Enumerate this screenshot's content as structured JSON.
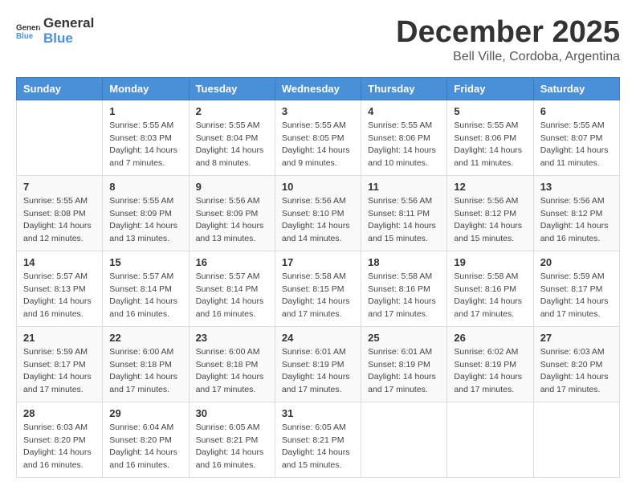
{
  "logo": {
    "general": "General",
    "blue": "Blue"
  },
  "header": {
    "month": "December 2025",
    "location": "Bell Ville, Cordoba, Argentina"
  },
  "weekdays": [
    "Sunday",
    "Monday",
    "Tuesday",
    "Wednesday",
    "Thursday",
    "Friday",
    "Saturday"
  ],
  "weeks": [
    [
      {
        "day": "",
        "sunrise": "",
        "sunset": "",
        "daylight": ""
      },
      {
        "day": "1",
        "sunrise": "Sunrise: 5:55 AM",
        "sunset": "Sunset: 8:03 PM",
        "daylight": "Daylight: 14 hours and 7 minutes."
      },
      {
        "day": "2",
        "sunrise": "Sunrise: 5:55 AM",
        "sunset": "Sunset: 8:04 PM",
        "daylight": "Daylight: 14 hours and 8 minutes."
      },
      {
        "day": "3",
        "sunrise": "Sunrise: 5:55 AM",
        "sunset": "Sunset: 8:05 PM",
        "daylight": "Daylight: 14 hours and 9 minutes."
      },
      {
        "day": "4",
        "sunrise": "Sunrise: 5:55 AM",
        "sunset": "Sunset: 8:06 PM",
        "daylight": "Daylight: 14 hours and 10 minutes."
      },
      {
        "day": "5",
        "sunrise": "Sunrise: 5:55 AM",
        "sunset": "Sunset: 8:06 PM",
        "daylight": "Daylight: 14 hours and 11 minutes."
      },
      {
        "day": "6",
        "sunrise": "Sunrise: 5:55 AM",
        "sunset": "Sunset: 8:07 PM",
        "daylight": "Daylight: 14 hours and 11 minutes."
      }
    ],
    [
      {
        "day": "7",
        "sunrise": "Sunrise: 5:55 AM",
        "sunset": "Sunset: 8:08 PM",
        "daylight": "Daylight: 14 hours and 12 minutes."
      },
      {
        "day": "8",
        "sunrise": "Sunrise: 5:55 AM",
        "sunset": "Sunset: 8:09 PM",
        "daylight": "Daylight: 14 hours and 13 minutes."
      },
      {
        "day": "9",
        "sunrise": "Sunrise: 5:56 AM",
        "sunset": "Sunset: 8:09 PM",
        "daylight": "Daylight: 14 hours and 13 minutes."
      },
      {
        "day": "10",
        "sunrise": "Sunrise: 5:56 AM",
        "sunset": "Sunset: 8:10 PM",
        "daylight": "Daylight: 14 hours and 14 minutes."
      },
      {
        "day": "11",
        "sunrise": "Sunrise: 5:56 AM",
        "sunset": "Sunset: 8:11 PM",
        "daylight": "Daylight: 14 hours and 15 minutes."
      },
      {
        "day": "12",
        "sunrise": "Sunrise: 5:56 AM",
        "sunset": "Sunset: 8:12 PM",
        "daylight": "Daylight: 14 hours and 15 minutes."
      },
      {
        "day": "13",
        "sunrise": "Sunrise: 5:56 AM",
        "sunset": "Sunset: 8:12 PM",
        "daylight": "Daylight: 14 hours and 16 minutes."
      }
    ],
    [
      {
        "day": "14",
        "sunrise": "Sunrise: 5:57 AM",
        "sunset": "Sunset: 8:13 PM",
        "daylight": "Daylight: 14 hours and 16 minutes."
      },
      {
        "day": "15",
        "sunrise": "Sunrise: 5:57 AM",
        "sunset": "Sunset: 8:14 PM",
        "daylight": "Daylight: 14 hours and 16 minutes."
      },
      {
        "day": "16",
        "sunrise": "Sunrise: 5:57 AM",
        "sunset": "Sunset: 8:14 PM",
        "daylight": "Daylight: 14 hours and 16 minutes."
      },
      {
        "day": "17",
        "sunrise": "Sunrise: 5:58 AM",
        "sunset": "Sunset: 8:15 PM",
        "daylight": "Daylight: 14 hours and 17 minutes."
      },
      {
        "day": "18",
        "sunrise": "Sunrise: 5:58 AM",
        "sunset": "Sunset: 8:16 PM",
        "daylight": "Daylight: 14 hours and 17 minutes."
      },
      {
        "day": "19",
        "sunrise": "Sunrise: 5:58 AM",
        "sunset": "Sunset: 8:16 PM",
        "daylight": "Daylight: 14 hours and 17 minutes."
      },
      {
        "day": "20",
        "sunrise": "Sunrise: 5:59 AM",
        "sunset": "Sunset: 8:17 PM",
        "daylight": "Daylight: 14 hours and 17 minutes."
      }
    ],
    [
      {
        "day": "21",
        "sunrise": "Sunrise: 5:59 AM",
        "sunset": "Sunset: 8:17 PM",
        "daylight": "Daylight: 14 hours and 17 minutes."
      },
      {
        "day": "22",
        "sunrise": "Sunrise: 6:00 AM",
        "sunset": "Sunset: 8:18 PM",
        "daylight": "Daylight: 14 hours and 17 minutes."
      },
      {
        "day": "23",
        "sunrise": "Sunrise: 6:00 AM",
        "sunset": "Sunset: 8:18 PM",
        "daylight": "Daylight: 14 hours and 17 minutes."
      },
      {
        "day": "24",
        "sunrise": "Sunrise: 6:01 AM",
        "sunset": "Sunset: 8:19 PM",
        "daylight": "Daylight: 14 hours and 17 minutes."
      },
      {
        "day": "25",
        "sunrise": "Sunrise: 6:01 AM",
        "sunset": "Sunset: 8:19 PM",
        "daylight": "Daylight: 14 hours and 17 minutes."
      },
      {
        "day": "26",
        "sunrise": "Sunrise: 6:02 AM",
        "sunset": "Sunset: 8:19 PM",
        "daylight": "Daylight: 14 hours and 17 minutes."
      },
      {
        "day": "27",
        "sunrise": "Sunrise: 6:03 AM",
        "sunset": "Sunset: 8:20 PM",
        "daylight": "Daylight: 14 hours and 17 minutes."
      }
    ],
    [
      {
        "day": "28",
        "sunrise": "Sunrise: 6:03 AM",
        "sunset": "Sunset: 8:20 PM",
        "daylight": "Daylight: 14 hours and 16 minutes."
      },
      {
        "day": "29",
        "sunrise": "Sunrise: 6:04 AM",
        "sunset": "Sunset: 8:20 PM",
        "daylight": "Daylight: 14 hours and 16 minutes."
      },
      {
        "day": "30",
        "sunrise": "Sunrise: 6:05 AM",
        "sunset": "Sunset: 8:21 PM",
        "daylight": "Daylight: 14 hours and 16 minutes."
      },
      {
        "day": "31",
        "sunrise": "Sunrise: 6:05 AM",
        "sunset": "Sunset: 8:21 PM",
        "daylight": "Daylight: 14 hours and 15 minutes."
      },
      {
        "day": "",
        "sunrise": "",
        "sunset": "",
        "daylight": ""
      },
      {
        "day": "",
        "sunrise": "",
        "sunset": "",
        "daylight": ""
      },
      {
        "day": "",
        "sunrise": "",
        "sunset": "",
        "daylight": ""
      }
    ]
  ]
}
